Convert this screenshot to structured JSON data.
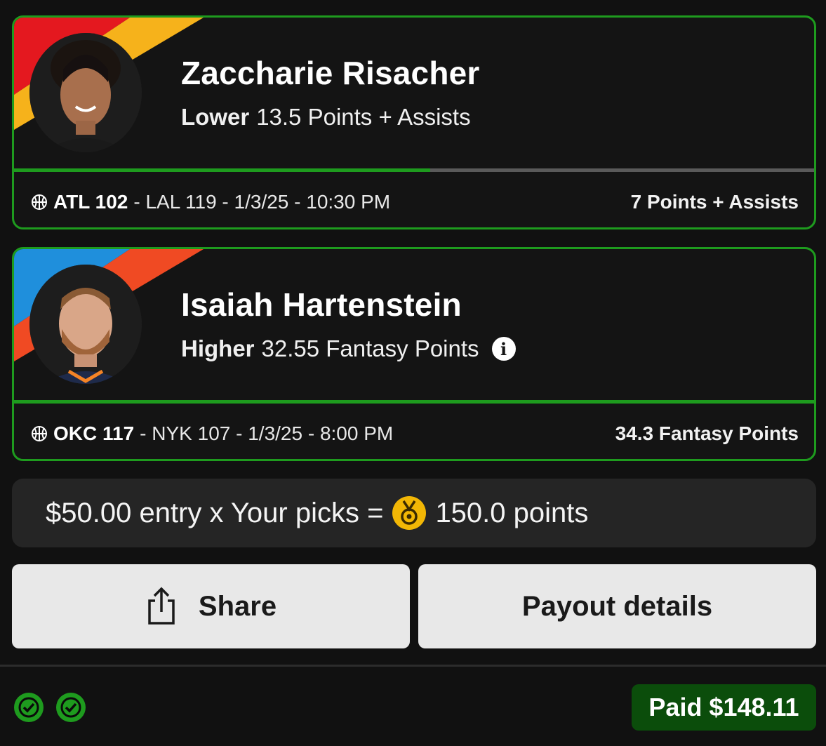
{
  "picks": [
    {
      "player_name": "Zaccharie Risacher",
      "direction": "Lower",
      "line": "13.5 Points + Assists",
      "has_info": false,
      "progress_fraction": 0.52,
      "team_home": "ATL 102",
      "game_rest": "- LAL 119 - 1/3/25 - 10:30 PM",
      "result": "7 Points + Assists",
      "stripe_colors": [
        "#e4181f",
        "#f6b21b"
      ]
    },
    {
      "player_name": "Isaiah Hartenstein",
      "direction": "Higher",
      "line": "32.55 Fantasy Points",
      "has_info": true,
      "progress_fraction": 1.0,
      "team_home": "OKC 117",
      "game_rest": "- NYK 107 - 1/3/25 - 8:00 PM",
      "result": "34.3 Fantasy Points",
      "stripe_colors": [
        "#1f8fdc",
        "#f04a23"
      ]
    }
  ],
  "entry": {
    "prefix": "$50.00 entry x Your picks =",
    "points": "150.0 points"
  },
  "buttons": {
    "share_label": "Share",
    "payout_label": "Payout details"
  },
  "footer": {
    "checks": 2,
    "paid_label": "Paid $148.11"
  },
  "colors": {
    "success_green": "#1e9b1e",
    "paid_bg": "#0b4d0b",
    "card_bg": "#141414",
    "medal_gold": "#f2b705"
  },
  "icons": [
    "basketball-icon",
    "info-icon",
    "medal-icon",
    "share-icon",
    "check-circle-icon"
  ]
}
